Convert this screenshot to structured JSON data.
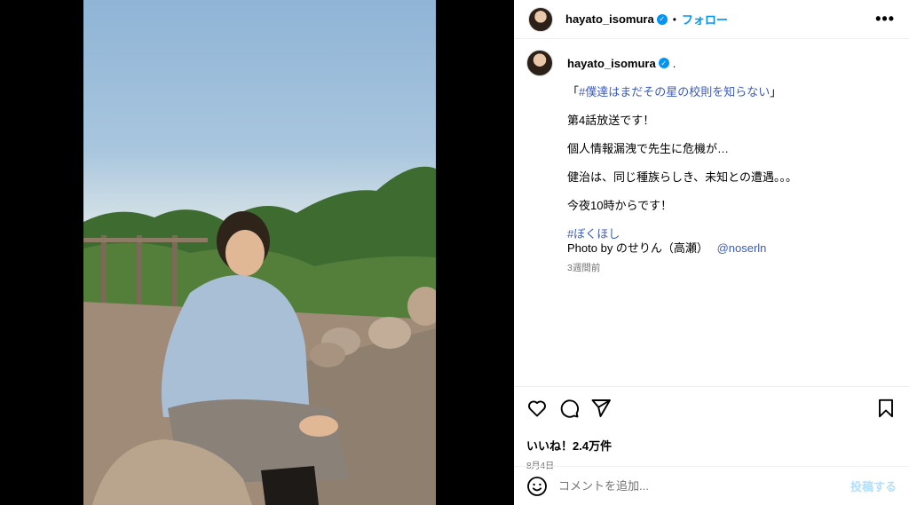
{
  "post": {
    "username": "hayato_isomura",
    "verified_badge": "✓",
    "separator": "•",
    "follow_label": "フォロー",
    "more_options": "•••"
  },
  "caption": {
    "username": "hayato_isomura",
    "trailing_dot": ".",
    "hashtag_title_open": "「",
    "hashtag_title": "#僕達はまだその星の校則を知らない",
    "hashtag_title_close": "」",
    "line1": "第4話放送です！",
    "line2": "個人情報漏洩で先生に危機が…",
    "line3": "健治は、同じ種族らしき、未知との遭遇。。。",
    "line4": "今夜10時からです！",
    "hashtag2": "#ぼくほし",
    "photo_credit_prefix": "Photo by のせりん（高瀬）",
    "photo_credit_mention": "@noserln",
    "time_ago": "3週間前"
  },
  "actions": {
    "like_icon": "heart-icon",
    "comment_icon": "comment-bubble-icon",
    "share_icon": "paper-plane-icon",
    "save_icon": "bookmark-icon",
    "likes_text": "いいね！2.4万件",
    "post_date": "8月4日"
  },
  "comment_box": {
    "placeholder": "コメントを追加...",
    "post_label": "投稿する",
    "emoji_icon": "smiley-icon"
  },
  "colors": {
    "accent_blue": "#0095f6",
    "link_blue": "#3b5bbd",
    "muted_text": "#737373",
    "post_button_disabled": "#b2dffc"
  }
}
